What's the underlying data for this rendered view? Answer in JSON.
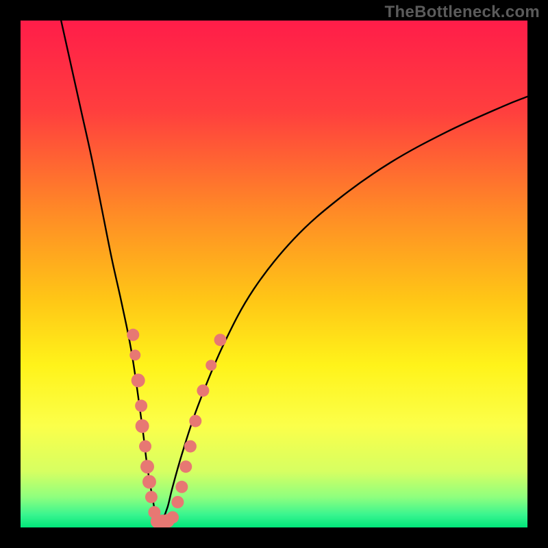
{
  "watermark": "TheBottleneck.com",
  "gradient_stops": [
    {
      "offset": 0.0,
      "color": "#ff1d49"
    },
    {
      "offset": 0.18,
      "color": "#ff3f3e"
    },
    {
      "offset": 0.38,
      "color": "#ff8b26"
    },
    {
      "offset": 0.55,
      "color": "#ffc616"
    },
    {
      "offset": 0.68,
      "color": "#fff31a"
    },
    {
      "offset": 0.8,
      "color": "#fbff4a"
    },
    {
      "offset": 0.89,
      "color": "#d6ff62"
    },
    {
      "offset": 0.94,
      "color": "#8fff7e"
    },
    {
      "offset": 0.975,
      "color": "#39f58f"
    },
    {
      "offset": 1.0,
      "color": "#00e67a"
    }
  ],
  "marker_color": "#e77873",
  "curve_color": "#000000",
  "chart_data": {
    "type": "line",
    "title": "",
    "xlabel": "",
    "ylabel": "",
    "xlim": [
      0,
      100
    ],
    "ylim": [
      0,
      100
    ],
    "x_minimum": 27,
    "series": [
      {
        "name": "left-branch",
        "x": [
          8,
          10,
          12,
          14,
          16,
          18,
          20,
          22,
          24,
          25,
          26,
          26.8,
          27
        ],
        "y": [
          100,
          91,
          82,
          73,
          63,
          53,
          44,
          34,
          20,
          12,
          6,
          1.5,
          0
        ]
      },
      {
        "name": "right-branch",
        "x": [
          27,
          28,
          29,
          30,
          32,
          35,
          40,
          46,
          54,
          63,
          73,
          84,
          95,
          100
        ],
        "y": [
          0,
          1.5,
          4,
          8,
          15,
          24,
          36,
          47,
          57,
          65,
          72,
          78,
          83,
          85
        ]
      }
    ],
    "markers": [
      {
        "x": 22.2,
        "y": 38,
        "r": 9
      },
      {
        "x": 22.6,
        "y": 34,
        "r": 8
      },
      {
        "x": 23.2,
        "y": 29,
        "r": 10
      },
      {
        "x": 23.8,
        "y": 24,
        "r": 9
      },
      {
        "x": 24.0,
        "y": 20,
        "r": 10
      },
      {
        "x": 24.6,
        "y": 16,
        "r": 9
      },
      {
        "x": 25.0,
        "y": 12,
        "r": 10
      },
      {
        "x": 25.4,
        "y": 9,
        "r": 10
      },
      {
        "x": 25.8,
        "y": 6,
        "r": 9
      },
      {
        "x": 26.4,
        "y": 3,
        "r": 9
      },
      {
        "x": 27.0,
        "y": 1.2,
        "r": 10
      },
      {
        "x": 28.0,
        "y": 1.2,
        "r": 10
      },
      {
        "x": 29.0,
        "y": 1.3,
        "r": 10
      },
      {
        "x": 30.0,
        "y": 2,
        "r": 9
      },
      {
        "x": 31.0,
        "y": 5,
        "r": 9
      },
      {
        "x": 31.8,
        "y": 8,
        "r": 9
      },
      {
        "x": 32.6,
        "y": 12,
        "r": 9
      },
      {
        "x": 33.5,
        "y": 16,
        "r": 9
      },
      {
        "x": 34.5,
        "y": 21,
        "r": 9
      },
      {
        "x": 36.0,
        "y": 27,
        "r": 9
      },
      {
        "x": 37.6,
        "y": 32,
        "r": 8
      },
      {
        "x": 39.4,
        "y": 37,
        "r": 9
      }
    ]
  }
}
